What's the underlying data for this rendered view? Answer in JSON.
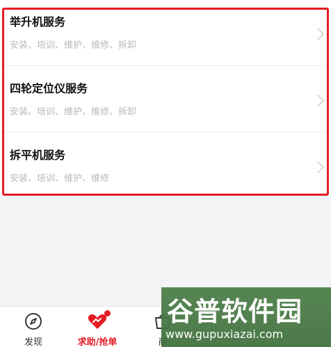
{
  "services": [
    {
      "title": "举升机服务",
      "desc": "安装、培训、维护、维修、拆卸"
    },
    {
      "title": "四轮定位仪服务",
      "desc": "安装、培训、维护、维修、拆卸"
    },
    {
      "title": "拆平机服务",
      "desc": "安装、培训、维护、维修"
    }
  ],
  "tabbar": {
    "discover": {
      "label": "发现",
      "icon": "compass-icon"
    },
    "help": {
      "label": "求助/抢单",
      "icon": "heart-hands-icon"
    },
    "shop": {
      "label": "商",
      "icon": "shop-icon"
    }
  },
  "watermark": {
    "title": "谷普软件园",
    "url": "www.gupuxiazai.com"
  },
  "colors": {
    "accent": "#e31b23",
    "watermark_bg": "#4a7f47",
    "background": "#f4f4f6"
  }
}
